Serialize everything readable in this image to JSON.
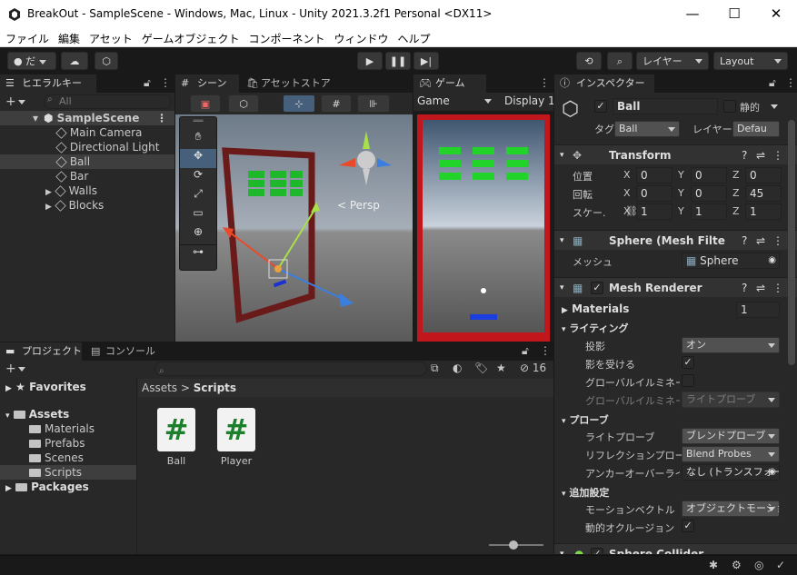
{
  "window": {
    "title": "BreakOut - SampleScene - Windows, Mac, Linux - Unity 2021.3.2f1 Personal <DX11>",
    "minimize": "—",
    "maximize": "☐",
    "close": "✕"
  },
  "menu": [
    "ファイル",
    "編集",
    "アセット",
    "ゲームオブジェクト",
    "コンポーネント",
    "ウィンドウ",
    "ヘルプ"
  ],
  "toolbar": {
    "account": "だ",
    "layers": "レイヤー",
    "layout": "Layout"
  },
  "hierarchy": {
    "tab": "ヒエラルキー",
    "search_placeholder": "All",
    "scene": "SampleScene",
    "items": [
      "Main Camera",
      "Directional Light",
      "Ball",
      "Bar",
      "Walls",
      "Blocks"
    ]
  },
  "scene_view": {
    "tab_scene": "シーン",
    "tab_store": "アセットストア",
    "persp": "< Persp"
  },
  "game_view": {
    "tab": "ゲーム",
    "display_mode": "Game",
    "display": "Display 1"
  },
  "project": {
    "tab_project": "プロジェクト",
    "tab_console": "コンソール",
    "favorites": "Favorites",
    "assets": "Assets",
    "folders": [
      "Materials",
      "Prefabs",
      "Scenes",
      "Scripts"
    ],
    "packages": "Packages",
    "breadcrumb_root": "Assets",
    "breadcrumb_sep": ">",
    "breadcrumb_current": "Scripts",
    "count": "16",
    "files": [
      "Ball",
      "Player"
    ],
    "script_glyph": "#"
  },
  "inspector": {
    "tab": "インスペクター",
    "name": "Ball",
    "static": "静的",
    "tag_label": "タグ",
    "tag": "Ball",
    "layer_label": "レイヤー",
    "layer": "Defau",
    "transform": {
      "title": "Transform",
      "pos_label": "位置",
      "rot_label": "回転",
      "scale_label": "スケー.",
      "pos": [
        "0",
        "0",
        "0"
      ],
      "rot": [
        "0",
        "0",
        "45"
      ],
      "scale": [
        "1",
        "1",
        "1"
      ]
    },
    "mesh_filter": {
      "title": "Sphere (Mesh Filter)",
      "mesh_label": "メッシュ",
      "mesh": "Sphere"
    },
    "mesh_renderer": {
      "title": "Mesh Renderer",
      "materials_label": "Materials",
      "materials_count": "1",
      "lighting": "ライティング",
      "cast_label": "投影",
      "cast": "オン",
      "receive_label": "影を受ける",
      "gi_label": "グローバルイルミネーシ",
      "gi2_label": "グローバルイルミネーシ",
      "gi2": "ライトプローブ",
      "probes": "プローブ",
      "light_probe_label": "ライトプローブ",
      "light_probe": "ブレンドプローブ",
      "refl_label": "リフレクションプローブ",
      "refl": "Blend Probes",
      "anchor_label": "アンカーオーバーライド",
      "anchor": "なし (トランスフォー",
      "extra": "追加設定",
      "motion_label": "モーションベクトル",
      "motion": "オブジェクトモーショ",
      "occl_label": "動的オクルージョン"
    },
    "collider": {
      "title": "Sphere Collider"
    },
    "axes": {
      "x": "X",
      "y": "Y",
      "z": "Z"
    },
    "check": "✓"
  }
}
